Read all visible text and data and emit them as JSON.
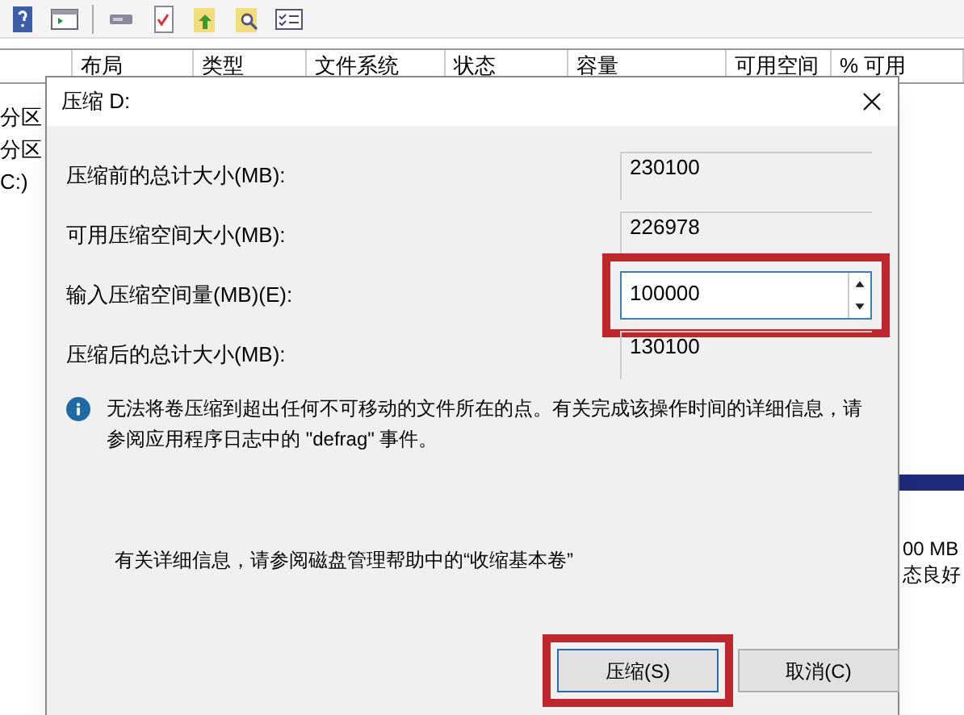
{
  "columns": [
    "布局",
    "类型",
    "文件系统",
    "状态",
    "容量",
    "可用空间",
    "% 可用"
  ],
  "left_labels": [
    "分区",
    "分区",
    "C:)"
  ],
  "right_labels": [
    "00 MB",
    "态良好"
  ],
  "dialog": {
    "title": "压缩 D:",
    "fields": [
      {
        "label": "压缩前的总计大小(MB):",
        "value": "230100",
        "kind": "readonly",
        "highlighted": false
      },
      {
        "label": "可用压缩空间大小(MB):",
        "value": "226978",
        "kind": "readonly",
        "highlighted": false
      },
      {
        "label": "输入压缩空间量(MB)(E):",
        "value": "100000",
        "kind": "spin",
        "highlighted": true
      },
      {
        "label": "压缩后的总计大小(MB):",
        "value": "130100",
        "kind": "readonly",
        "highlighted": false
      }
    ],
    "info": "无法将卷压缩到超出任何不可移动的文件所在的点。有关完成该操作时间的详细信息，请参阅应用程序日志中的 \"defrag\" 事件。",
    "help_text": "有关详细信息，请参阅磁盘管理帮助中的“收缩基本卷”",
    "buttons": [
      {
        "label": "压缩(S)",
        "highlighted": true
      },
      {
        "label": "取消(C)",
        "highlighted": false
      }
    ]
  }
}
